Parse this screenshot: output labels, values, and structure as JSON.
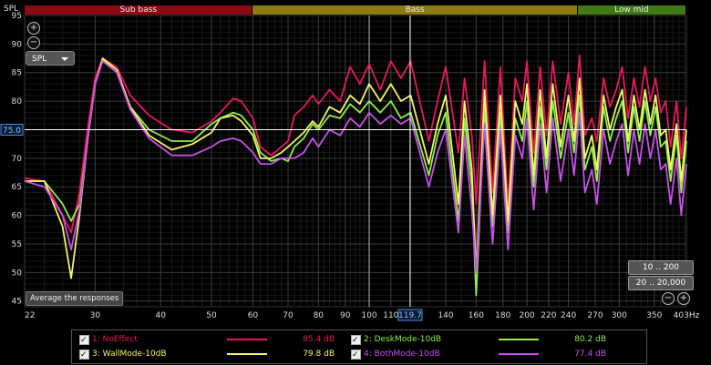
{
  "chart_data": {
    "type": "line",
    "ylabel": "SPL",
    "xunit": "Hz",
    "xlim": [
      22,
      403
    ],
    "ylim": [
      44,
      95
    ],
    "xscale": "log",
    "yticks": [
      45,
      50,
      55,
      60,
      65,
      70,
      75,
      80,
      85,
      90,
      95
    ],
    "xticks": [
      22,
      30,
      40,
      50,
      60,
      70,
      80,
      90,
      100,
      110,
      140,
      160,
      180,
      200,
      220,
      240,
      270,
      300,
      350,
      403
    ],
    "xtick_labels": [
      "22",
      "30",
      "40",
      "50",
      "60",
      "70",
      "80",
      "90",
      "100",
      "110",
      "140",
      "160",
      "180",
      "200",
      "220",
      "240",
      "270",
      "300",
      "350",
      "403Hz"
    ],
    "bands": [
      {
        "label": "Sub bass",
        "from": 22,
        "to": 60,
        "color": "#8b0a14"
      },
      {
        "label": "Bass",
        "from": 60,
        "to": 250,
        "color": "#8c7a12"
      },
      {
        "label": "Low mid",
        "from": 250,
        "to": 403,
        "color": "#3f7a16"
      }
    ],
    "cursor": {
      "x": 119.7,
      "x_label": "119.7",
      "y": 75.0,
      "y_label": "75.0"
    },
    "vline_x": 100,
    "grid": true,
    "series": [
      {
        "name": "1: NoEffect",
        "color": "#e8185a",
        "value_label": "85.4 dB",
        "points": [
          [
            22,
            66.5
          ],
          [
            24,
            66
          ],
          [
            26,
            60
          ],
          [
            27,
            57
          ],
          [
            28,
            64
          ],
          [
            29,
            75
          ],
          [
            30,
            84
          ],
          [
            31,
            87.5
          ],
          [
            33,
            86
          ],
          [
            35,
            81
          ],
          [
            38,
            77.5
          ],
          [
            42,
            75
          ],
          [
            46,
            74.5
          ],
          [
            50,
            76.5
          ],
          [
            52,
            78
          ],
          [
            55,
            80.5
          ],
          [
            57,
            80
          ],
          [
            60,
            77
          ],
          [
            62,
            72
          ],
          [
            65,
            70.5
          ],
          [
            68,
            72
          ],
          [
            70,
            73
          ],
          [
            72,
            77.5
          ],
          [
            75,
            79
          ],
          [
            78,
            81
          ],
          [
            80,
            79.5
          ],
          [
            84,
            82
          ],
          [
            88,
            80
          ],
          [
            92,
            86
          ],
          [
            96,
            83
          ],
          [
            100,
            86.5
          ],
          [
            105,
            82
          ],
          [
            110,
            87
          ],
          [
            115,
            84
          ],
          [
            120,
            87
          ],
          [
            130,
            73
          ],
          [
            135,
            80
          ],
          [
            140,
            86
          ],
          [
            148,
            71
          ],
          [
            152,
            84
          ],
          [
            157,
            74
          ],
          [
            160,
            62
          ],
          [
            166,
            87
          ],
          [
            172,
            64
          ],
          [
            178,
            86
          ],
          [
            184,
            62
          ],
          [
            190,
            84
          ],
          [
            196,
            80
          ],
          [
            200,
            87
          ],
          [
            206,
            71
          ],
          [
            212,
            86
          ],
          [
            218,
            74
          ],
          [
            224,
            87
          ],
          [
            232,
            76
          ],
          [
            240,
            85
          ],
          [
            246,
            76
          ],
          [
            252,
            88
          ],
          [
            258,
            74
          ],
          [
            266,
            77
          ],
          [
            272,
            73
          ],
          [
            280,
            84
          ],
          [
            288,
            79
          ],
          [
            296,
            82
          ],
          [
            304,
            86
          ],
          [
            312,
            77
          ],
          [
            320,
            84
          ],
          [
            328,
            79
          ],
          [
            336,
            86
          ],
          [
            344,
            80
          ],
          [
            352,
            84
          ],
          [
            360,
            78
          ],
          [
            368,
            80
          ],
          [
            376,
            72
          ],
          [
            386,
            80
          ],
          [
            394,
            70
          ],
          [
            403,
            79
          ]
        ]
      },
      {
        "name": "2: DeskMode-10dB",
        "color": "#8cf04a",
        "value_label": "80.2 dB",
        "points": [
          [
            22,
            66
          ],
          [
            24,
            66
          ],
          [
            26,
            62
          ],
          [
            27,
            59
          ],
          [
            28,
            62
          ],
          [
            29,
            73
          ],
          [
            30,
            83
          ],
          [
            31,
            87.3
          ],
          [
            33,
            85
          ],
          [
            35,
            79
          ],
          [
            38,
            75
          ],
          [
            42,
            73
          ],
          [
            46,
            73
          ],
          [
            50,
            76
          ],
          [
            52,
            77
          ],
          [
            55,
            78
          ],
          [
            57,
            77.5
          ],
          [
            60,
            75
          ],
          [
            62,
            71
          ],
          [
            65,
            69.5
          ],
          [
            68,
            70
          ],
          [
            70,
            69.5
          ],
          [
            72,
            72
          ],
          [
            75,
            73.5
          ],
          [
            78,
            76
          ],
          [
            80,
            75
          ],
          [
            84,
            77.5
          ],
          [
            88,
            77
          ],
          [
            92,
            79.5
          ],
          [
            96,
            78
          ],
          [
            100,
            80
          ],
          [
            105,
            78
          ],
          [
            110,
            80
          ],
          [
            115,
            77
          ],
          [
            120,
            78
          ],
          [
            130,
            67
          ],
          [
            135,
            74
          ],
          [
            140,
            78
          ],
          [
            148,
            59
          ],
          [
            152,
            77
          ],
          [
            157,
            65
          ],
          [
            160,
            46
          ],
          [
            166,
            79
          ],
          [
            172,
            58
          ],
          [
            178,
            78
          ],
          [
            184,
            57
          ],
          [
            190,
            77
          ],
          [
            196,
            73
          ],
          [
            200,
            80
          ],
          [
            206,
            65
          ],
          [
            212,
            79
          ],
          [
            218,
            68
          ],
          [
            224,
            80
          ],
          [
            232,
            70
          ],
          [
            240,
            78
          ],
          [
            246,
            71
          ],
          [
            252,
            81
          ],
          [
            258,
            68
          ],
          [
            266,
            72
          ],
          [
            272,
            66
          ],
          [
            280,
            79
          ],
          [
            288,
            73
          ],
          [
            296,
            77
          ],
          [
            304,
            80
          ],
          [
            312,
            71
          ],
          [
            320,
            79
          ],
          [
            328,
            73
          ],
          [
            336,
            80
          ],
          [
            344,
            74
          ],
          [
            352,
            79
          ],
          [
            360,
            72
          ],
          [
            368,
            73
          ],
          [
            376,
            66
          ],
          [
            386,
            74
          ],
          [
            394,
            64
          ],
          [
            403,
            73
          ]
        ]
      },
      {
        "name": "3: WallMode-10dB",
        "color": "#f4f468",
        "value_label": "79.8 dB",
        "points": [
          [
            22,
            66
          ],
          [
            24,
            66
          ],
          [
            26,
            58
          ],
          [
            27,
            49
          ],
          [
            28,
            60
          ],
          [
            29,
            73
          ],
          [
            30,
            83
          ],
          [
            31,
            87.5
          ],
          [
            33,
            85.5
          ],
          [
            35,
            79
          ],
          [
            38,
            74
          ],
          [
            42,
            71.5
          ],
          [
            46,
            72.5
          ],
          [
            50,
            74.5
          ],
          [
            52,
            77
          ],
          [
            55,
            77.5
          ],
          [
            57,
            76.5
          ],
          [
            60,
            74
          ],
          [
            62,
            70
          ],
          [
            65,
            70
          ],
          [
            68,
            71
          ],
          [
            70,
            72
          ],
          [
            72,
            73
          ],
          [
            75,
            74.5
          ],
          [
            78,
            76.5
          ],
          [
            80,
            75.5
          ],
          [
            84,
            79
          ],
          [
            88,
            78
          ],
          [
            92,
            81
          ],
          [
            96,
            79.5
          ],
          [
            100,
            83
          ],
          [
            105,
            80
          ],
          [
            110,
            83
          ],
          [
            115,
            80
          ],
          [
            120,
            81
          ],
          [
            130,
            69
          ],
          [
            135,
            76
          ],
          [
            140,
            81
          ],
          [
            148,
            62
          ],
          [
            152,
            80
          ],
          [
            157,
            68
          ],
          [
            160,
            50
          ],
          [
            166,
            82
          ],
          [
            172,
            60
          ],
          [
            178,
            81
          ],
          [
            184,
            59
          ],
          [
            190,
            80
          ],
          [
            196,
            76
          ],
          [
            200,
            83
          ],
          [
            206,
            67
          ],
          [
            212,
            82
          ],
          [
            218,
            70
          ],
          [
            224,
            83
          ],
          [
            232,
            72
          ],
          [
            240,
            81
          ],
          [
            246,
            73
          ],
          [
            252,
            84
          ],
          [
            258,
            70
          ],
          [
            266,
            74
          ],
          [
            272,
            68
          ],
          [
            280,
            81
          ],
          [
            288,
            75
          ],
          [
            296,
            79
          ],
          [
            304,
            82
          ],
          [
            312,
            73
          ],
          [
            320,
            81
          ],
          [
            328,
            75
          ],
          [
            336,
            82
          ],
          [
            344,
            76
          ],
          [
            352,
            81
          ],
          [
            360,
            74
          ],
          [
            368,
            75
          ],
          [
            376,
            68
          ],
          [
            386,
            76
          ],
          [
            394,
            66
          ],
          [
            403,
            75
          ]
        ]
      },
      {
        "name": "4: BothMode-10dB",
        "color": "#c850e8",
        "value_label": "77.4 dB",
        "points": [
          [
            22,
            66
          ],
          [
            24,
            65
          ],
          [
            26,
            60
          ],
          [
            27,
            54
          ],
          [
            28,
            61
          ],
          [
            29,
            73
          ],
          [
            30,
            83
          ],
          [
            31,
            87
          ],
          [
            33,
            85
          ],
          [
            35,
            78.5
          ],
          [
            38,
            73.5
          ],
          [
            42,
            70.5
          ],
          [
            46,
            70.5
          ],
          [
            50,
            72
          ],
          [
            52,
            73
          ],
          [
            55,
            73.5
          ],
          [
            57,
            73
          ],
          [
            60,
            71
          ],
          [
            62,
            69
          ],
          [
            65,
            69
          ],
          [
            68,
            70
          ],
          [
            70,
            70
          ],
          [
            72,
            70
          ],
          [
            75,
            71
          ],
          [
            78,
            73.5
          ],
          [
            80,
            72
          ],
          [
            84,
            75
          ],
          [
            88,
            74
          ],
          [
            92,
            77
          ],
          [
            96,
            75.5
          ],
          [
            100,
            78
          ],
          [
            105,
            76
          ],
          [
            110,
            77.5
          ],
          [
            115,
            76
          ],
          [
            120,
            77
          ],
          [
            130,
            65
          ],
          [
            135,
            71
          ],
          [
            140,
            75
          ],
          [
            148,
            57
          ],
          [
            152,
            74
          ],
          [
            157,
            61
          ],
          [
            160,
            50
          ],
          [
            166,
            76
          ],
          [
            172,
            55
          ],
          [
            178,
            75
          ],
          [
            184,
            54
          ],
          [
            190,
            74
          ],
          [
            196,
            70
          ],
          [
            200,
            77
          ],
          [
            206,
            61
          ],
          [
            212,
            76
          ],
          [
            218,
            64
          ],
          [
            224,
            77
          ],
          [
            232,
            66
          ],
          [
            240,
            75
          ],
          [
            246,
            67
          ],
          [
            252,
            78
          ],
          [
            258,
            64
          ],
          [
            266,
            68
          ],
          [
            272,
            62
          ],
          [
            280,
            75
          ],
          [
            288,
            69
          ],
          [
            296,
            73
          ],
          [
            304,
            76
          ],
          [
            312,
            67
          ],
          [
            320,
            75
          ],
          [
            328,
            69
          ],
          [
            336,
            76
          ],
          [
            344,
            70
          ],
          [
            352,
            75
          ],
          [
            360,
            68
          ],
          [
            368,
            69
          ],
          [
            376,
            62
          ],
          [
            386,
            70
          ],
          [
            394,
            60
          ],
          [
            403,
            69
          ]
        ]
      }
    ]
  },
  "controls": {
    "spl_select_value": "SPL",
    "average_button_label": "Average the responses",
    "range_btn_1": "10 .. 200",
    "range_btn_2": "20 .. 20,000",
    "zoom_in_symbol": "+",
    "zoom_out_symbol": "−"
  }
}
